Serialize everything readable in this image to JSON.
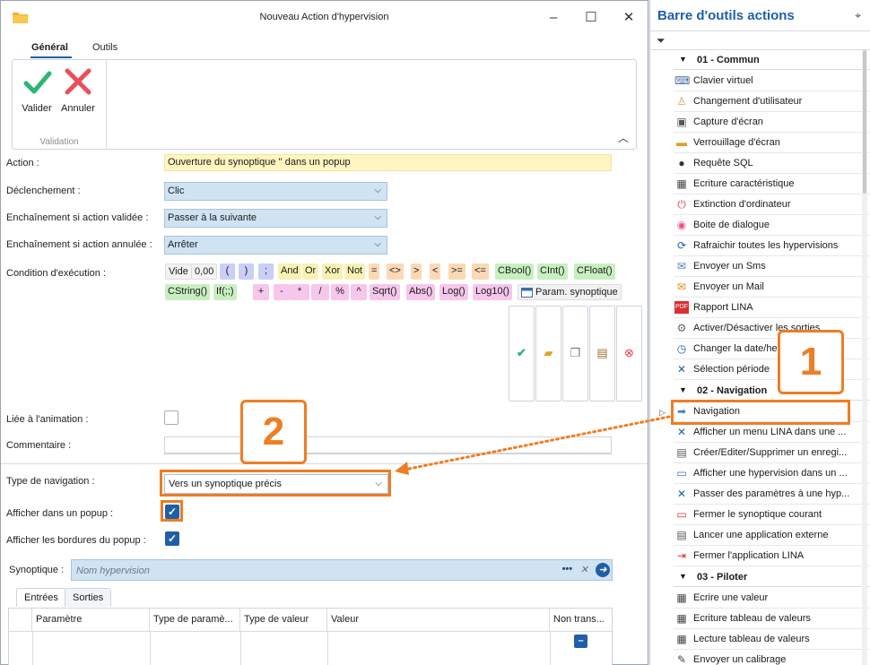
{
  "dialog": {
    "title": "Nouveau Action d'hypervision",
    "tabs": [
      "Général",
      "Outils"
    ],
    "ribbon": {
      "validate_label": "Valider",
      "cancel_label": "Annuler",
      "group_label": "Validation"
    },
    "fields": {
      "action_label": "Action :",
      "action_value": "Ouverture du synoptique '' dans un popup",
      "trigger_label": "Déclenchement :",
      "trigger_value": "Clic",
      "on_valid_label": "Enchaînement si action validée :",
      "on_valid_value": "Passer à la suivante",
      "on_cancel_label": "Enchaînement si action annulée :",
      "on_cancel_value": "Arrêter",
      "condition_label": "Condition d'exécution :",
      "linked_label": "Liée à l'animation :",
      "comment_label": "Commentaire :",
      "nav_type_label": "Type de navigation :",
      "nav_type_value": "Vers un synoptique précis",
      "popup_label": "Afficher dans un popup :",
      "borders_label": "Afficher les bordures du popup :",
      "synoptic_label": "Synoptique :",
      "synoptic_placeholder": "Nom hypervision"
    },
    "tokens_row1": [
      "Vide",
      "0,00",
      "(",
      ")",
      ";",
      "And",
      "Or",
      "Xor",
      "Not",
      "=",
      "<>",
      ">",
      "<",
      ">=",
      "<=",
      "CBool()",
      "CInt()",
      "CFloat()"
    ],
    "tokens_row2": [
      "CString()",
      "If(;;)",
      "+",
      "-",
      "*",
      "/",
      "%",
      "^",
      "Sqrt()",
      "Abs()",
      "Log()",
      "Log10()",
      "Param. synoptique"
    ],
    "subtabs": [
      "Entrées",
      "Sorties"
    ],
    "grid_headers": [
      "Paramètre",
      "Type de paramè...",
      "Type de valeur",
      "Valeur",
      "Non trans..."
    ]
  },
  "callouts": {
    "one": "1",
    "two": "2"
  },
  "panel": {
    "title": "Barre d'outils actions",
    "groups": [
      {
        "label": "01 - Commun",
        "items": [
          {
            "label": "Clavier virtuel",
            "icon": "keyboard-icon"
          },
          {
            "label": "Changement d'utilisateur",
            "icon": "user-icon"
          },
          {
            "label": "Capture d'écran",
            "icon": "screenshot-icon"
          },
          {
            "label": "Verrouillage d'écran",
            "icon": "lock-icon"
          },
          {
            "label": "Requête SQL",
            "icon": "database-icon"
          },
          {
            "label": "Ecriture caractéristique",
            "icon": "grid-icon"
          },
          {
            "label": "Extinction d'ordinateur",
            "icon": "power-icon"
          },
          {
            "label": "Boite de dialogue",
            "icon": "dialog-icon"
          },
          {
            "label": "Rafraichir toutes les hypervisions",
            "icon": "refresh-icon"
          },
          {
            "label": "Envoyer un Sms",
            "icon": "sms-icon"
          },
          {
            "label": "Envoyer un Mail",
            "icon": "mail-icon"
          },
          {
            "label": "Rapport LINA",
            "icon": "pdf-icon"
          },
          {
            "label": "Activer/Désactiver les sorties",
            "icon": "gear-icon"
          },
          {
            "label": "Changer la date/heure",
            "icon": "clock-icon"
          },
          {
            "label": "Sélection période",
            "icon": "period-icon"
          }
        ]
      },
      {
        "label": "02 - Navigation",
        "items": [
          {
            "label": "Navigation",
            "icon": "arrow-right-icon"
          },
          {
            "label": "Afficher un menu LINA dans une ...",
            "icon": "menu-icon"
          },
          {
            "label": "Créer/Editer/Supprimer un enregi...",
            "icon": "edit-icon"
          },
          {
            "label": "Afficher une hypervision dans un ...",
            "icon": "window-icon"
          },
          {
            "label": "Passer des paramètres à une hyp...",
            "icon": "params-icon"
          },
          {
            "label": "Fermer le synoptique courant",
            "icon": "close-window-icon"
          },
          {
            "label": "Lancer une application externe",
            "icon": "launch-icon"
          },
          {
            "label": "Fermer l'application LINA",
            "icon": "exit-icon"
          }
        ]
      },
      {
        "label": "03 - Piloter",
        "items": [
          {
            "label": "Ecrire une valeur",
            "icon": "write-icon"
          },
          {
            "label": "Ecriture tableau de valeurs",
            "icon": "table-write-icon"
          },
          {
            "label": "Lecture tableau de valeurs",
            "icon": "table-read-icon"
          },
          {
            "label": "Envoyer un calibrage",
            "icon": "calibrate-icon"
          }
        ]
      }
    ]
  }
}
